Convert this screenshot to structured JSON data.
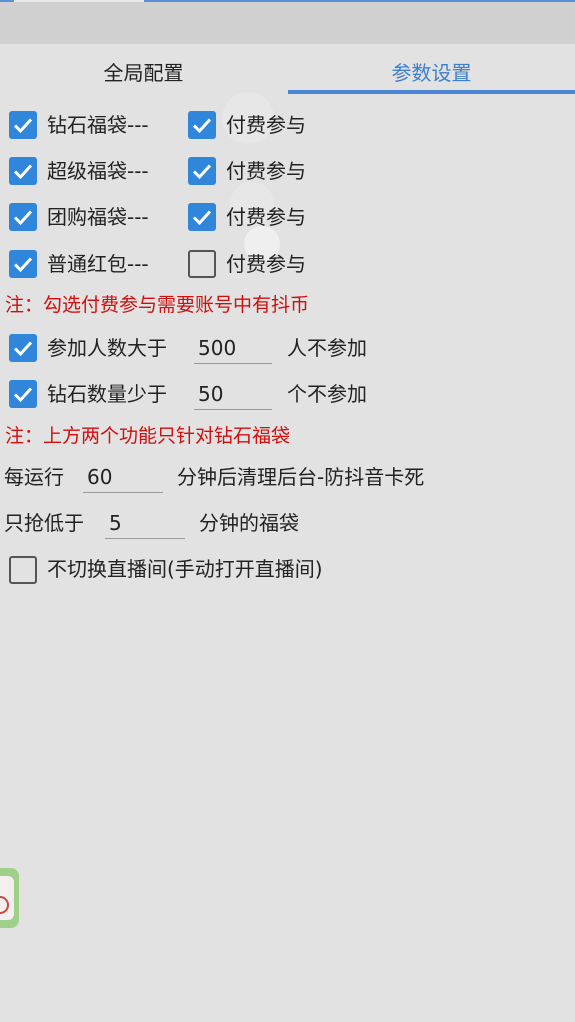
{
  "tabs": [
    {
      "label": "全局配置",
      "selected": false
    },
    {
      "label": "参数设置",
      "selected": true
    }
  ],
  "accent_color": "#2f86db",
  "rows": [
    {
      "main_label": "钻石福袋---",
      "main_checked": true,
      "paid_label": "付费参与",
      "paid_checked": true
    },
    {
      "main_label": "超级福袋---",
      "main_checked": true,
      "paid_label": "付费参与",
      "paid_checked": true
    },
    {
      "main_label": "团购福袋---",
      "main_checked": true,
      "paid_label": "付费参与",
      "paid_checked": true
    },
    {
      "main_label": "普通红包---",
      "main_checked": true,
      "paid_label": "付费参与",
      "paid_checked": false
    }
  ],
  "note1": "注：勾选付费参与需要账号中有抖币",
  "participants": {
    "checked": true,
    "prefix": "参加人数大于",
    "value": "500",
    "suffix": "人不参加"
  },
  "diamonds": {
    "checked": true,
    "prefix": "钻石数量少于",
    "value": "50",
    "suffix": "个不参加"
  },
  "note2": "注：上方两个功能只针对钻石福袋",
  "cleanup": {
    "prefix": "每运行",
    "value": "60",
    "suffix": "分钟后清理后台-防抖音卡死"
  },
  "grab": {
    "prefix": "只抢低于",
    "value": "5",
    "suffix": "分钟的福袋"
  },
  "no_switch": {
    "checked": false,
    "label": "不切换直播间(手动打开直播间)"
  }
}
